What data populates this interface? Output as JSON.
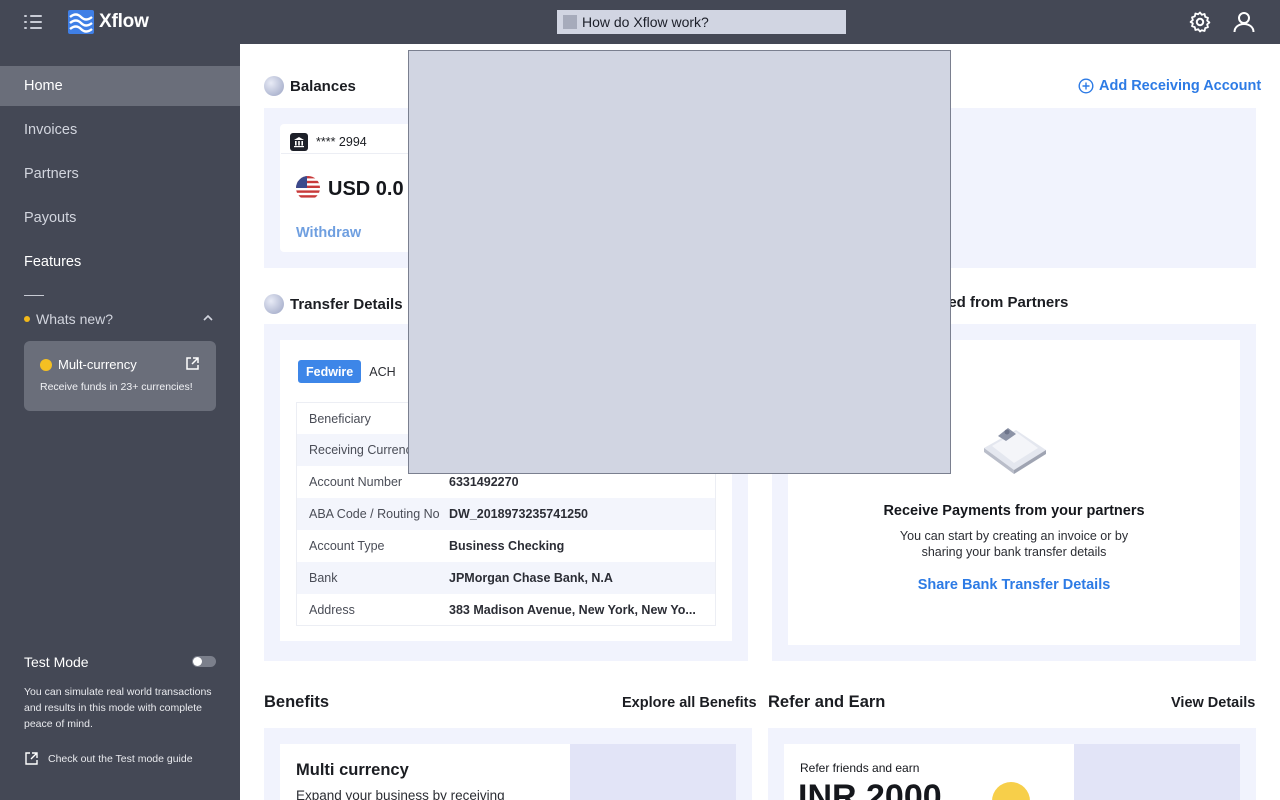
{
  "app": {
    "name": "Xflow"
  },
  "search": {
    "text": "How do Xflow work?"
  },
  "sidebar": {
    "items": [
      {
        "label": "Home"
      },
      {
        "label": "Invoices"
      },
      {
        "label": "Partners"
      },
      {
        "label": "Payouts"
      },
      {
        "label": "Features"
      }
    ],
    "whats_new": "Whats new?",
    "feature_card": {
      "title": "Mult-currency",
      "subtitle": "Receive funds in 23+ currencies!"
    },
    "test_mode": {
      "label": "Test Mode",
      "enabled": false,
      "description": "You can simulate real world transactions and results in this mode with complete peace of mind.",
      "guide_link": "Check out the Test mode guide"
    }
  },
  "balances": {
    "title": "Balances",
    "add_account": "Add Receiving Account",
    "account_mask": "**** 2994",
    "amount": "USD 0.0",
    "withdraw": "Withdraw"
  },
  "transfer": {
    "title": "Transfer Details",
    "tabs": [
      "Fedwire",
      "ACH"
    ],
    "rows": [
      {
        "key": "Beneficiary",
        "value": ""
      },
      {
        "key": "Receiving Currenc",
        "value": ""
      },
      {
        "key": "Account Number",
        "value": "6331492270"
      },
      {
        "key": "ABA Code / Routing No",
        "value": "DW_2018973235741250"
      },
      {
        "key": "Account Type",
        "value": "Business Checking"
      },
      {
        "key": "Bank",
        "value": "JPMorgan Chase Bank, N.A"
      },
      {
        "key": "Address",
        "value": "383 Madison Avenue, New York, New Yo..."
      }
    ]
  },
  "partners": {
    "title": "ved from Partners",
    "empty_title": "Receive Payments from your partners",
    "empty_desc_1": "You can start by creating an invoice or by",
    "empty_desc_2": "sharing your bank transfer details",
    "link": "Share Bank Transfer Details"
  },
  "benefits": {
    "title": "Benefits",
    "explore": "Explore all Benefits",
    "card_title": "Multi currency",
    "card_desc": "Expand your business by receiving"
  },
  "refer": {
    "title": "Refer and Earn",
    "view": "View Details",
    "small": "Refer friends and earn",
    "big": "INR 2000"
  },
  "colors": {
    "accent": "#2d7be5",
    "sidebar": "#444855",
    "panel": "#f1f3fd"
  }
}
